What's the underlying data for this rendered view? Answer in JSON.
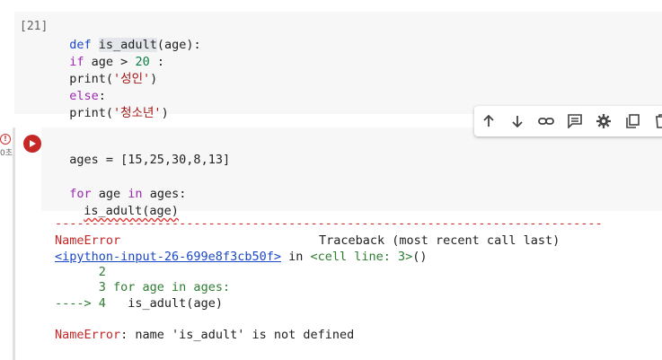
{
  "cell1": {
    "prompt": "[21]",
    "lines": [
      {
        "kw": "def",
        "fn": "is_adult",
        "rest": "(age):"
      },
      {
        "kw": "if",
        "rest": " age > ",
        "num": "20",
        "tail": " :"
      },
      {
        "fn": "print",
        "open": "(",
        "str": "'성인'",
        "close": ")"
      },
      {
        "kw": "else",
        "rest": ":"
      },
      {
        "fn": "print",
        "open": "(",
        "str": "'청소년'",
        "close": ")"
      }
    ]
  },
  "cell2": {
    "error_marker": "!",
    "exec_time": "0초",
    "line1": "ages = [15,25,30,8,13]",
    "line3_kw1": "for",
    "line3_mid": " age ",
    "line3_kw2": "in",
    "line3_rest": " ages:",
    "line4": "is_adult(age)"
  },
  "toolbar": {
    "icons": [
      "arrow-up-icon",
      "arrow-down-icon",
      "link-icon",
      "comment-icon",
      "gear-icon",
      "mirror-cell-icon",
      "delete-icon"
    ]
  },
  "output": {
    "dashes": "---------------------------------------------------------------------------",
    "error_name": "NameError",
    "traceback_label": "Traceback (most recent call last)",
    "input_link": "<ipython-input-26-699e8f3cb50f>",
    "in_word": " in ",
    "cell_line": "<cell line: 3>",
    "cell_line_tail": "()",
    "tb_line2": "      2",
    "tb_line3_num": "      3 ",
    "tb_line3_code": "for age in ages:",
    "tb_arrow": "----> 4",
    "tb_line4_code": "   is_adult(age)",
    "final_error_name": "NameError",
    "final_error_msg": ": name 'is_adult' is not defined"
  }
}
